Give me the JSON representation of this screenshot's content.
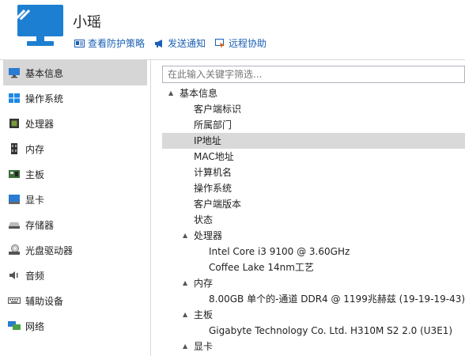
{
  "header": {
    "title": "小瑶",
    "actions": [
      {
        "label": "查看防护策略",
        "icon": "policy-icon"
      },
      {
        "label": "发送通知",
        "icon": "megaphone-icon"
      },
      {
        "label": "远程协助",
        "icon": "remote-icon"
      }
    ]
  },
  "colors": {
    "accent": "#1d7fd1",
    "link": "#1a5fb4",
    "selected": "#d6d6d6"
  },
  "sidebar": {
    "items": [
      {
        "label": "基本信息",
        "icon": "computer-icon"
      },
      {
        "label": "操作系统",
        "icon": "windows-icon"
      },
      {
        "label": "处理器",
        "icon": "cpu-icon"
      },
      {
        "label": "内存",
        "icon": "memory-icon"
      },
      {
        "label": "主板",
        "icon": "motherboard-icon"
      },
      {
        "label": "显卡",
        "icon": "display-card-icon"
      },
      {
        "label": "存储器",
        "icon": "storage-icon"
      },
      {
        "label": "光盘驱动器",
        "icon": "optical-drive-icon"
      },
      {
        "label": "音频",
        "icon": "audio-icon"
      },
      {
        "label": "辅助设备",
        "icon": "keyboard-icon"
      },
      {
        "label": "网络",
        "icon": "network-icon"
      }
    ]
  },
  "search": {
    "placeholder": "在此输入关键字筛选..."
  },
  "tree": {
    "rows": [
      {
        "label": "基本信息",
        "expander": "▲"
      },
      {
        "label": "客户端标识",
        "expander": ""
      },
      {
        "label": "所属部门",
        "expander": ""
      },
      {
        "label": "IP地址",
        "expander": ""
      },
      {
        "label": "MAC地址",
        "expander": ""
      },
      {
        "label": "计算机名",
        "expander": ""
      },
      {
        "label": "操作系统",
        "expander": ""
      },
      {
        "label": "客户端版本",
        "expander": ""
      },
      {
        "label": "状态",
        "expander": ""
      },
      {
        "label": "处理器",
        "expander": "▲"
      },
      {
        "label": "Intel Core i3 9100 @ 3.60GHz",
        "expander": ""
      },
      {
        "label": "Coffee Lake 14nm工艺",
        "expander": ""
      },
      {
        "label": "内存",
        "expander": "▲"
      },
      {
        "label": "8.00GB 单个的-通道 DDR4 @ 1199兆赫兹 (19-19-19-43)",
        "expander": ""
      },
      {
        "label": "主板",
        "expander": "▲"
      },
      {
        "label": "Gigabyte Technology Co. Ltd. H310M S2 2.0 (U3E1)",
        "expander": ""
      },
      {
        "label": "显卡",
        "expander": "▲"
      }
    ]
  }
}
